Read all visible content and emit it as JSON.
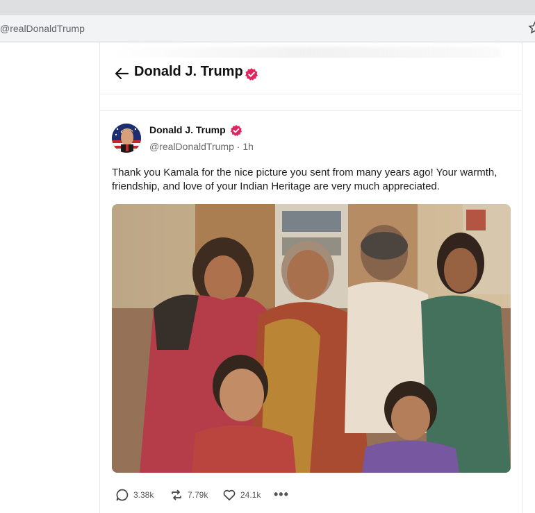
{
  "browser": {
    "url": "@realDonaldTrump"
  },
  "header": {
    "title": "Donald J. Trump"
  },
  "post": {
    "author_name": "Donald J. Trump",
    "handle": "@realDonaldTrump",
    "time": "1h",
    "text": "Thank you Kamala for the nice picture you sent from many years ago! Your warmth, friendship, and love of your Indian Heritage are very much appreciated.",
    "actions": {
      "replies": "3.38k",
      "reposts": "7.79k",
      "likes": "24.1k"
    }
  },
  "colors": {
    "verified": "#e0245e",
    "text": "#0f1419",
    "muted": "#6b6b6b"
  },
  "icons": [
    "back-arrow-icon",
    "verified-icon",
    "star-icon",
    "reply-icon",
    "repost-icon",
    "like-icon",
    "more-icon"
  ]
}
